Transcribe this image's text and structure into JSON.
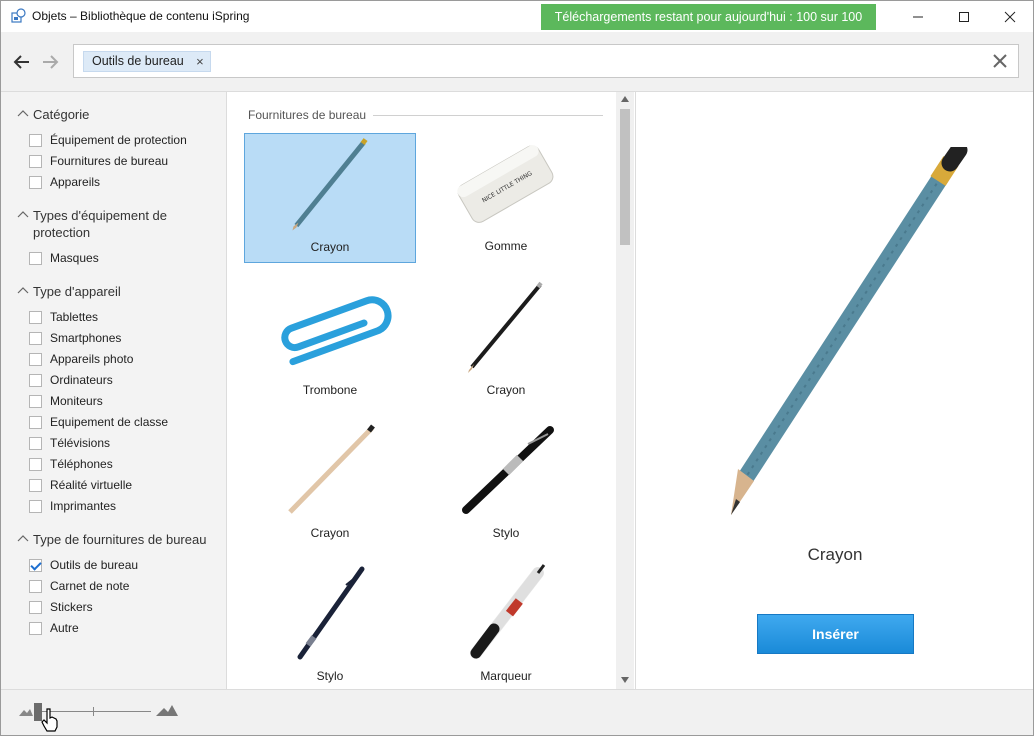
{
  "window": {
    "title": "Objets – Bibliothèque de contenu iSpring",
    "downloads_badge": "Téléchargements restant pour aujourd'hui : 100 sur 100",
    "badge_color": "#5cb85c"
  },
  "search": {
    "chip_label": "Outils de bureau"
  },
  "sidebar": {
    "groups": [
      {
        "title": "Catégorie",
        "items": [
          {
            "label": "Équipement de protection",
            "checked": false
          },
          {
            "label": "Fournitures de bureau",
            "checked": false
          },
          {
            "label": "Appareils",
            "checked": false
          }
        ]
      },
      {
        "title_line1": "Types d'équipement de",
        "title_line2": "protection",
        "items": [
          {
            "label": "Masques",
            "checked": false
          }
        ]
      },
      {
        "title": "Type d'appareil",
        "items": [
          {
            "label": "Tablettes",
            "checked": false
          },
          {
            "label": "Smartphones",
            "checked": false
          },
          {
            "label": "Appareils photo",
            "checked": false
          },
          {
            "label": "Ordinateurs",
            "checked": false
          },
          {
            "label": "Moniteurs",
            "checked": false
          },
          {
            "label": "Equipement de classe",
            "checked": false
          },
          {
            "label": "Télévisions",
            "checked": false
          },
          {
            "label": "Téléphones",
            "checked": false
          },
          {
            "label": "Réalité virtuelle",
            "checked": false
          },
          {
            "label": "Imprimantes",
            "checked": false
          }
        ]
      },
      {
        "title": "Type de fournitures de bureau",
        "items": [
          {
            "label": "Outils de bureau",
            "checked": true
          },
          {
            "label": "Carnet de note",
            "checked": false
          },
          {
            "label": "Stickers",
            "checked": false
          },
          {
            "label": "Autre",
            "checked": false
          }
        ]
      }
    ]
  },
  "grid": {
    "section_title": "Fournitures de bureau",
    "items": [
      {
        "label": "Crayon",
        "icon": "blue-pencil-icon",
        "selected": true
      },
      {
        "label": "Gomme",
        "icon": "eraser-icon",
        "selected": false
      },
      {
        "label": "Trombone",
        "icon": "paperclip-icon",
        "selected": false
      },
      {
        "label": "Crayon",
        "icon": "black-pencil-icon",
        "selected": false
      },
      {
        "label": "Crayon",
        "icon": "wood-pencil-icon",
        "selected": false
      },
      {
        "label": "Stylo",
        "icon": "pen-icon",
        "selected": false
      },
      {
        "label": "Stylo",
        "icon": "ballpoint-pen-icon",
        "selected": false
      },
      {
        "label": "Marqueur",
        "icon": "marker-icon",
        "selected": false
      }
    ],
    "selection_color": "#b9dcf6"
  },
  "preview": {
    "name": "Crayon",
    "insert_label": "Insérer",
    "button_color": "#1a8ad8"
  },
  "zoom": {
    "level": 0.0
  }
}
